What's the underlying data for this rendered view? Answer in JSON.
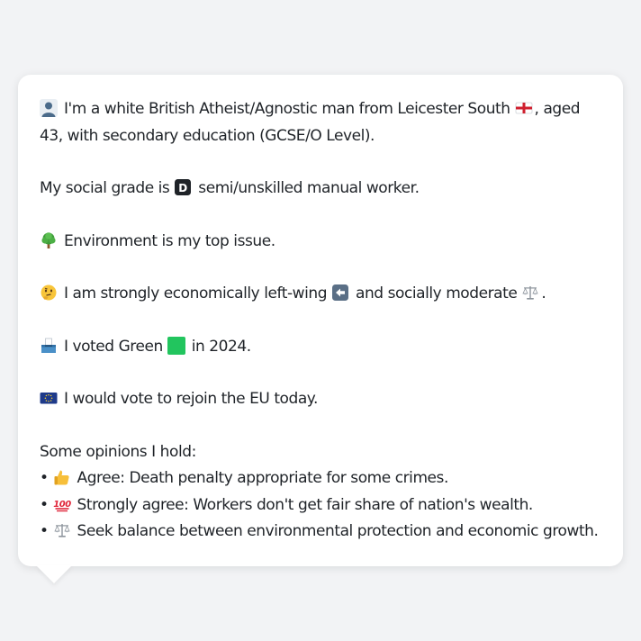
{
  "profile": {
    "intro": {
      "icon": "person-silhouette-icon",
      "text_a": "I'm a white British Atheist/Agnostic man from Leicester South",
      "flag_icon": "england-flag-icon",
      "text_b": ", aged 43, with secondary education (GCSE/O Level)."
    },
    "grade": {
      "prefix": "My social grade is",
      "badge_icon": "letter-d-badge-icon",
      "badge_letter": "D",
      "suffix": "semi/unskilled manual worker."
    },
    "issue": {
      "icon": "tree-icon",
      "text": "Environment is my top issue."
    },
    "stance": {
      "icon": "thinking-face-icon",
      "text_a": "I am strongly economically left-wing",
      "left_icon": "left-arrow-icon",
      "text_b": "and socially moderate",
      "scale_icon": "balance-scale-icon",
      "text_c": "."
    },
    "vote": {
      "icon": "ballot-box-icon",
      "text_a": "I voted Green",
      "party_icon": "green-square-icon",
      "text_b": "in 2024."
    },
    "eu": {
      "icon": "eu-flag-icon",
      "text": "I would vote to rejoin the EU today."
    },
    "opinions": {
      "heading": "Some opinions I hold:",
      "items": [
        {
          "bullet": "•",
          "icon": "thumbs-up-icon",
          "text": "Agree: Death penalty appropriate for some crimes."
        },
        {
          "bullet": "•",
          "icon": "hundred-points-icon",
          "text": "Strongly agree: Workers don't get fair share of nation's wealth."
        },
        {
          "bullet": "•",
          "icon": "balance-scale-icon",
          "text": "Seek balance between environmental protection and economic growth."
        }
      ]
    }
  },
  "colors": {
    "background": "#f2f3f5",
    "card": "#ffffff",
    "text": "#1f2328",
    "green_party": "#22c55e",
    "eu_blue": "#1e3a8a"
  }
}
